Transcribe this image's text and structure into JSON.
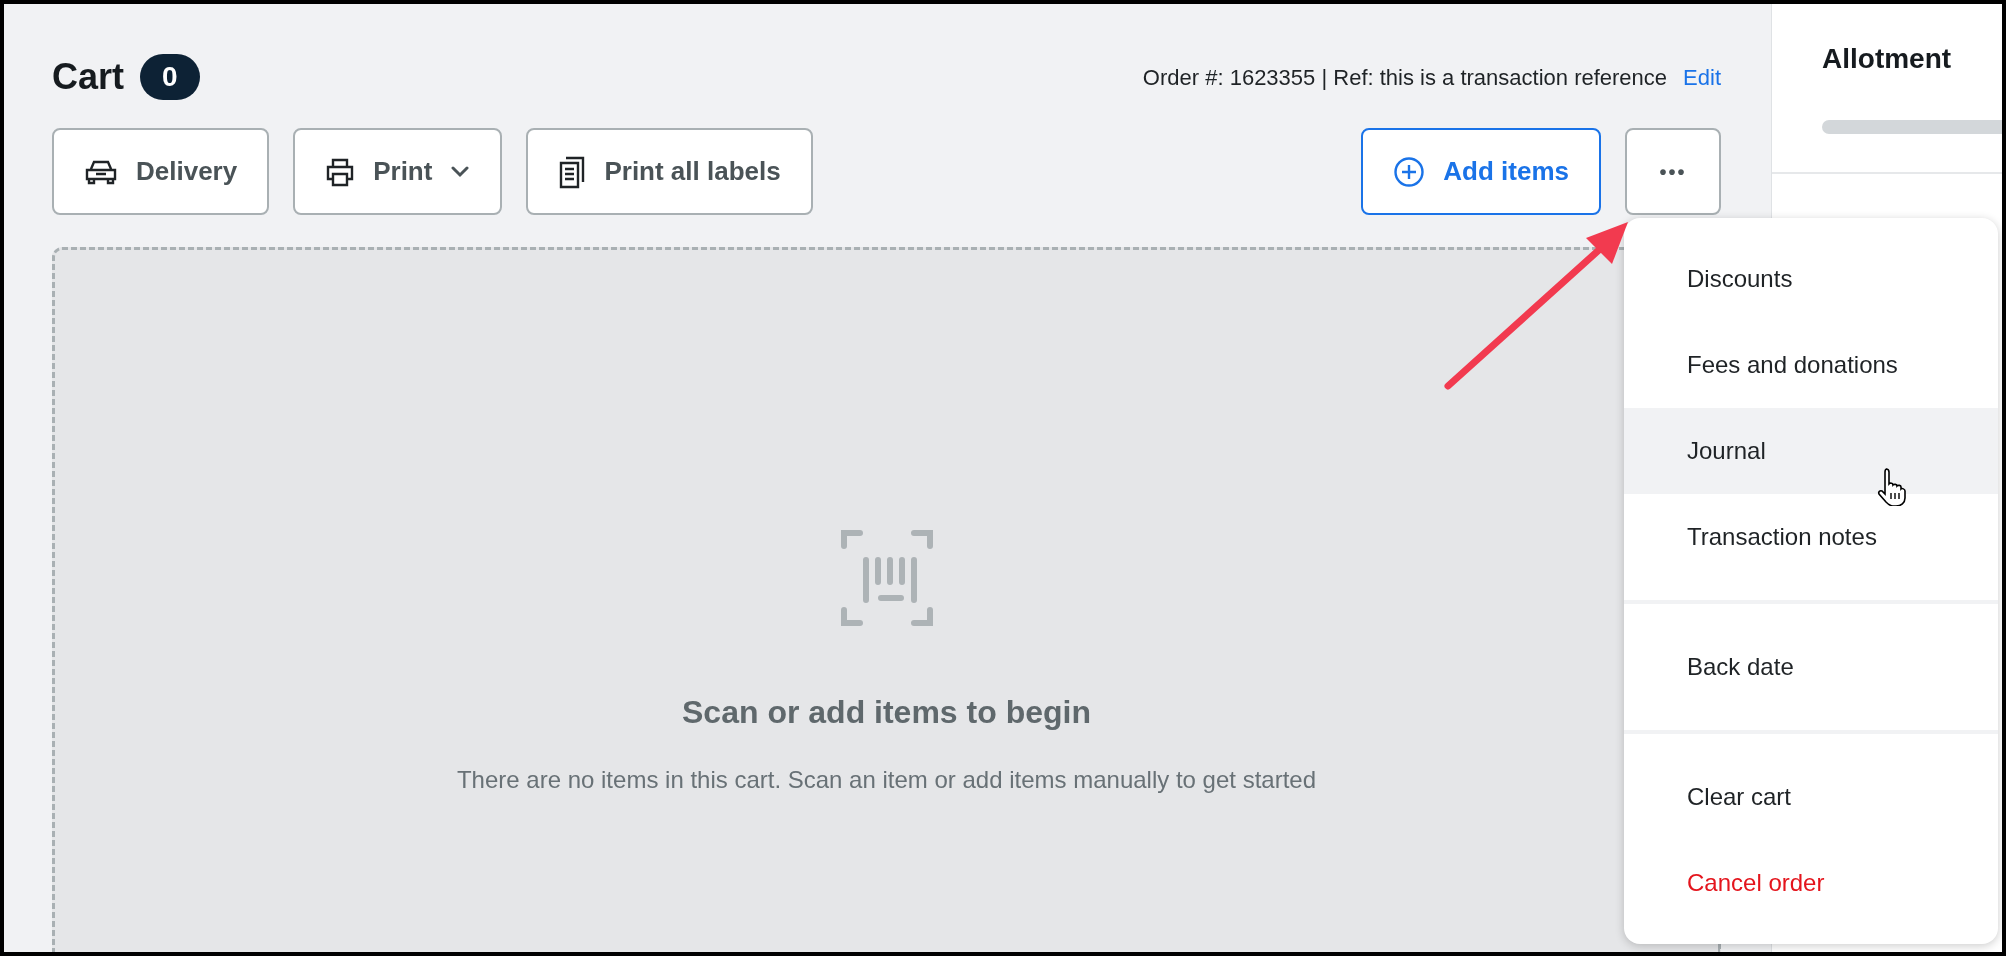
{
  "cart": {
    "title": "Cart",
    "count": "0"
  },
  "order_info": {
    "text": "Order #: 1623355 | Ref: this is a transaction reference",
    "edit_link": "Edit"
  },
  "toolbar_left": [
    {
      "label": "Delivery",
      "kind": "car",
      "dropdown": false
    },
    {
      "label": "Print",
      "kind": "printer",
      "dropdown": true
    },
    {
      "label": "Print all labels",
      "kind": "documents",
      "dropdown": false
    }
  ],
  "toolbar_right": {
    "add_button": "Add items",
    "more_button": "•••"
  },
  "empty_state": {
    "heading": "Scan or add items to begin",
    "message": "There are no items in this cart. Scan an item or add items manually to get started"
  },
  "side_panel": {
    "title": "Allotment"
  },
  "menu": {
    "groups": [
      [
        {
          "label": "Discounts",
          "hovered": false,
          "kind": "normal"
        },
        {
          "label": "Fees and donations",
          "hovered": false,
          "kind": "normal"
        },
        {
          "label": "Journal",
          "hovered": true,
          "kind": "normal"
        },
        {
          "label": "Transaction notes",
          "hovered": false,
          "kind": "normal"
        }
      ],
      [
        {
          "label": "Back date",
          "hovered": false,
          "kind": "normal"
        }
      ],
      [
        {
          "label": "Clear cart",
          "hovered": false,
          "kind": "normal"
        },
        {
          "label": "Cancel order",
          "hovered": false,
          "kind": "danger"
        }
      ]
    ]
  }
}
